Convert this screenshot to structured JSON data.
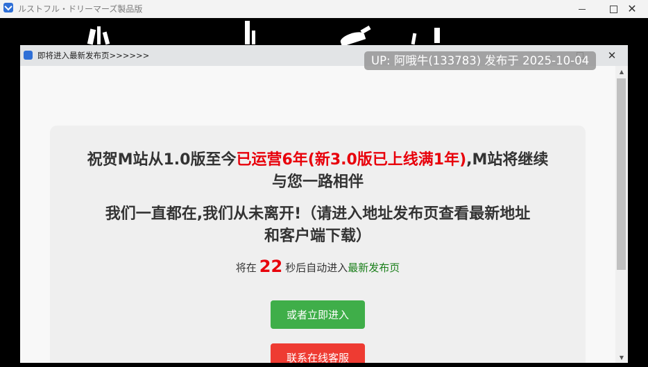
{
  "outer_window": {
    "title": "ルストフル・ドリーマーズ製品版"
  },
  "dialog": {
    "title": "即将进入最新发布页>>>>>>",
    "uploader_badge": "UP: 阿哦牛(133783) 发布于 2025-10-04",
    "heading1": {
      "part1": "祝贺M站从1.0版至今",
      "part2_red": "已运营6年(新3.0版已上线满1年)",
      "part3": ",M站将继续",
      "line2": "与您一路相伴"
    },
    "heading2": {
      "line1": "我们一直都在,我们从未离开!（请进入地址发布页查看最新地址",
      "line2": "和客户端下载）"
    },
    "countdown": {
      "prefix": "将在",
      "seconds": "22",
      "suffix": "秒后自动进入",
      "link": "最新发布页"
    },
    "buttons": {
      "enter_now": "或者立即进入",
      "online_service": "联系在线客服"
    }
  },
  "colors": {
    "accent_red": "#e8000b",
    "button_green": "#3fae49",
    "button_red": "#ee3b32",
    "link_green": "#1a7f1a"
  },
  "icons": [
    "app-icon",
    "minimize-icon",
    "maximize-icon",
    "close-icon",
    "scroll-up-icon",
    "scroll-down-icon"
  ]
}
